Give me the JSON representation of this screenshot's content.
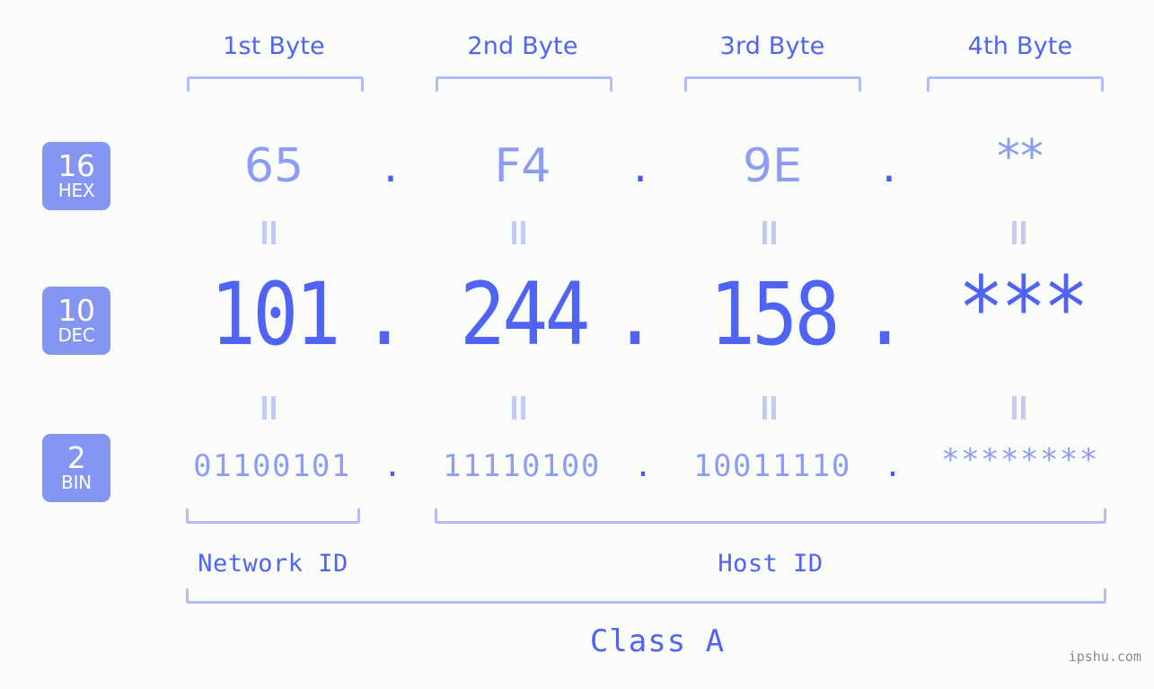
{
  "background_color": "#fbfdfa",
  "accent_color": "#4f63f5",
  "muted_accent_color": "#8e9df4",
  "bracket_color": "#b3bdfb",
  "badge_color": "#8496f2",
  "headers": {
    "byte1": "1st Byte",
    "byte2": "2nd Byte",
    "byte3": "3rd Byte",
    "byte4": "4th Byte"
  },
  "rows": {
    "hex": {
      "badge_number": "16",
      "badge_name": "HEX",
      "values": [
        "65",
        "F4",
        "9E",
        "**"
      ],
      "separator": "."
    },
    "dec": {
      "badge_number": "10",
      "badge_name": "DEC",
      "values": [
        "101",
        "244",
        "158",
        "***"
      ],
      "separator": "."
    },
    "bin": {
      "badge_number": "2",
      "badge_name": "BIN",
      "values": [
        "01100101",
        "11110100",
        "10011110",
        "********"
      ],
      "separator": "."
    }
  },
  "footer": {
    "network_id": "Network ID",
    "host_id": "Host ID",
    "class_label": "Class A",
    "watermark": "ipshu.com"
  }
}
